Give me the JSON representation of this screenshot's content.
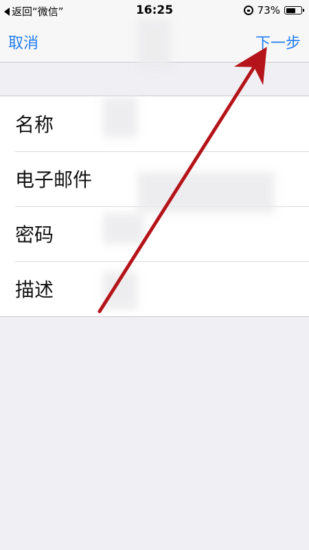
{
  "status_bar": {
    "back_text": "返回“微信”",
    "time": "16:25",
    "battery_percent": "73%",
    "battery_level": 0.73
  },
  "nav": {
    "cancel_label": "取消",
    "next_label": "下一步"
  },
  "form": {
    "rows": [
      {
        "label": "名称",
        "value": ""
      },
      {
        "label": "电子邮件",
        "value": ""
      },
      {
        "label": "密码",
        "value": ""
      },
      {
        "label": "描述",
        "value": ""
      }
    ]
  },
  "colors": {
    "accent": "#1f7ef0",
    "annotation_arrow": "#b5141a",
    "background": "#efeff4"
  },
  "icons": {
    "back": "back-triangle-icon",
    "rotation_lock": "rotation-lock-icon",
    "battery": "battery-icon"
  }
}
